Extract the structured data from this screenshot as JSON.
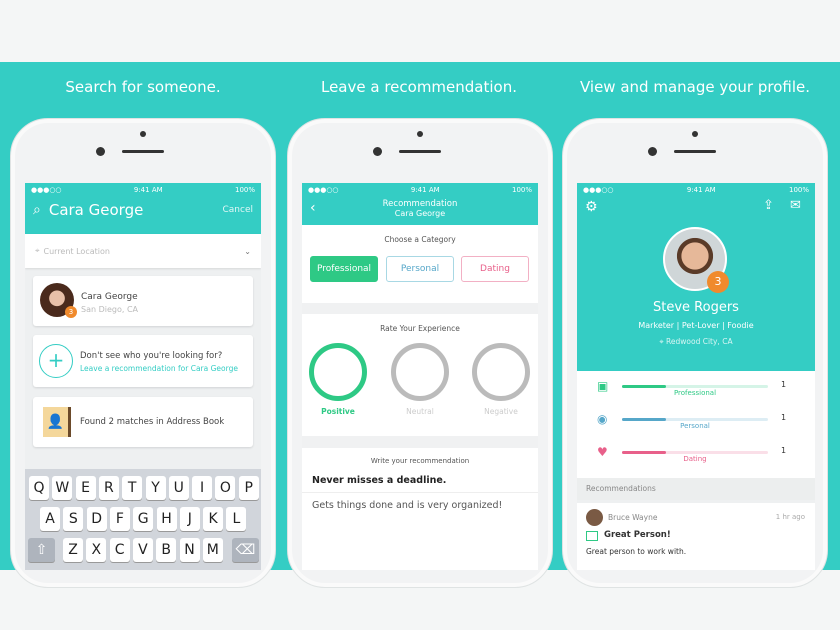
{
  "captions": [
    "Search for someone.",
    "Leave a recommendation.",
    "View and manage your profile."
  ],
  "status": {
    "time": "9:41 AM",
    "battery": "100%"
  },
  "colors": {
    "teal": "#34cdc4",
    "green": "#2ec985",
    "blue": "#56a7c9",
    "pink": "#e8608a",
    "orange": "#f08a2c"
  },
  "search": {
    "query": "Cara George",
    "cancel": "Cancel",
    "location_placeholder": "Current Location",
    "result": {
      "name": "Cara George",
      "location": "San Diego, CA",
      "badge": "3"
    },
    "not_found": {
      "title": "Don't see who you're looking for?",
      "link": "Leave a recommendation for Cara George"
    },
    "address_book": "Found 2 matches in Address Book",
    "keyboard": [
      [
        "Q",
        "W",
        "E",
        "R",
        "T",
        "Y",
        "U",
        "I",
        "O",
        "P"
      ],
      [
        "A",
        "S",
        "D",
        "F",
        "G",
        "H",
        "J",
        "K",
        "L"
      ],
      [
        "Z",
        "X",
        "C",
        "V",
        "B",
        "N",
        "M"
      ]
    ]
  },
  "recommend": {
    "title": "Recommendation",
    "subtitle": "Cara George",
    "choose_label": "Choose a Category",
    "categories": [
      "Professional",
      "Personal",
      "Dating"
    ],
    "rate_label": "Rate Your Experience",
    "ratings": [
      "Positive",
      "Neutral",
      "Negative"
    ],
    "selected_rating": "Positive",
    "write_label": "Write your recommendation",
    "headline": "Never misses a deadline.",
    "body": "Gets things done and is very organized!"
  },
  "profile": {
    "name": "Steve Rogers",
    "tagline": "Marketer | Pet-Lover | Foodie",
    "location": "Redwood City, CA",
    "badge": "3",
    "stats": [
      {
        "label": "Professional",
        "count": "1"
      },
      {
        "label": "Personal",
        "count": "1"
      },
      {
        "label": "Dating",
        "count": "1"
      }
    ],
    "recommendations_label": "Recommendations",
    "recommendation": {
      "author": "Bruce Wayne",
      "time": "1 hr ago",
      "title": "Great Person!",
      "text": "Great person to work with."
    }
  }
}
